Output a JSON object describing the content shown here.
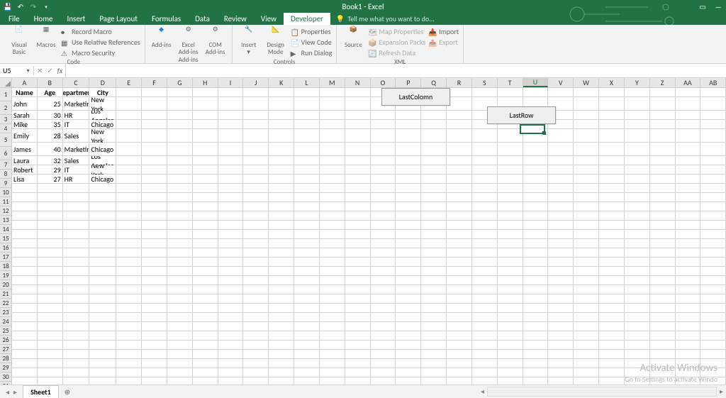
{
  "titlebar": {
    "title": "Book1 - Excel"
  },
  "tabs": [
    "File",
    "Home",
    "Insert",
    "Page Layout",
    "Formulas",
    "Data",
    "Review",
    "View",
    "Developer"
  ],
  "tellme": "Tell me what you want to do...",
  "ribbon": {
    "code": {
      "visualBasic": "Visual Basic",
      "macros": "Macros",
      "recordMacro": "Record Macro",
      "useRel": "Use Relative References",
      "macroSec": "Macro Security",
      "label": "Code"
    },
    "addins": {
      "addins": "Add-ins",
      "excelAddins": "Excel Add-ins",
      "comAddins": "COM Add-ins",
      "label": "Add-ins"
    },
    "controls": {
      "insert": "Insert",
      "designMode": "Design Mode",
      "properties": "Properties",
      "viewCode": "View Code",
      "runDialog": "Run Dialog",
      "label": "Controls"
    },
    "xml": {
      "source": "Source",
      "mapProperties": "Map Properties",
      "expansionPacks": "Expansion Packs",
      "refreshData": "Refresh Data",
      "import": "Import",
      "export": "Export",
      "label": "XML"
    }
  },
  "nameBox": "U5",
  "columns": [
    "A",
    "B",
    "C",
    "D",
    "E",
    "F",
    "G",
    "H",
    "I",
    "J",
    "K",
    "L",
    "M",
    "N",
    "O",
    "P",
    "Q",
    "R",
    "S",
    "T",
    "U",
    "V",
    "W",
    "X",
    "Y",
    "Z",
    "AA",
    "AB"
  ],
  "tableHeaders": [
    "Name",
    "Age",
    "Department",
    "City"
  ],
  "rows": [
    {
      "name": "John",
      "age": 25,
      "dept": "Marketing",
      "city": "New York"
    },
    {
      "name": "Sarah",
      "age": 30,
      "dept": "HR",
      "city": "Los Angeles"
    },
    {
      "name": "Mike",
      "age": 35,
      "dept": "IT",
      "city": "Chicago"
    },
    {
      "name": "Emily",
      "age": 28,
      "dept": "Sales",
      "city": "New York"
    },
    {
      "name": "James",
      "age": 40,
      "dept": "Marketing",
      "city": "Chicago"
    },
    {
      "name": "Laura",
      "age": 32,
      "dept": "Sales",
      "city": "Los Angeles"
    },
    {
      "name": "Robert",
      "age": 29,
      "dept": "IT",
      "city": "New York"
    },
    {
      "name": "Lisa",
      "age": 27,
      "dept": "HR",
      "city": "Chicago"
    }
  ],
  "buttons": {
    "lastColumn": "LastColomn",
    "lastRow": "LastRow"
  },
  "sheet": "Sheet1",
  "watermark": {
    "title": "Activate Windows",
    "sub": "Go to Settings to activate Windo"
  }
}
